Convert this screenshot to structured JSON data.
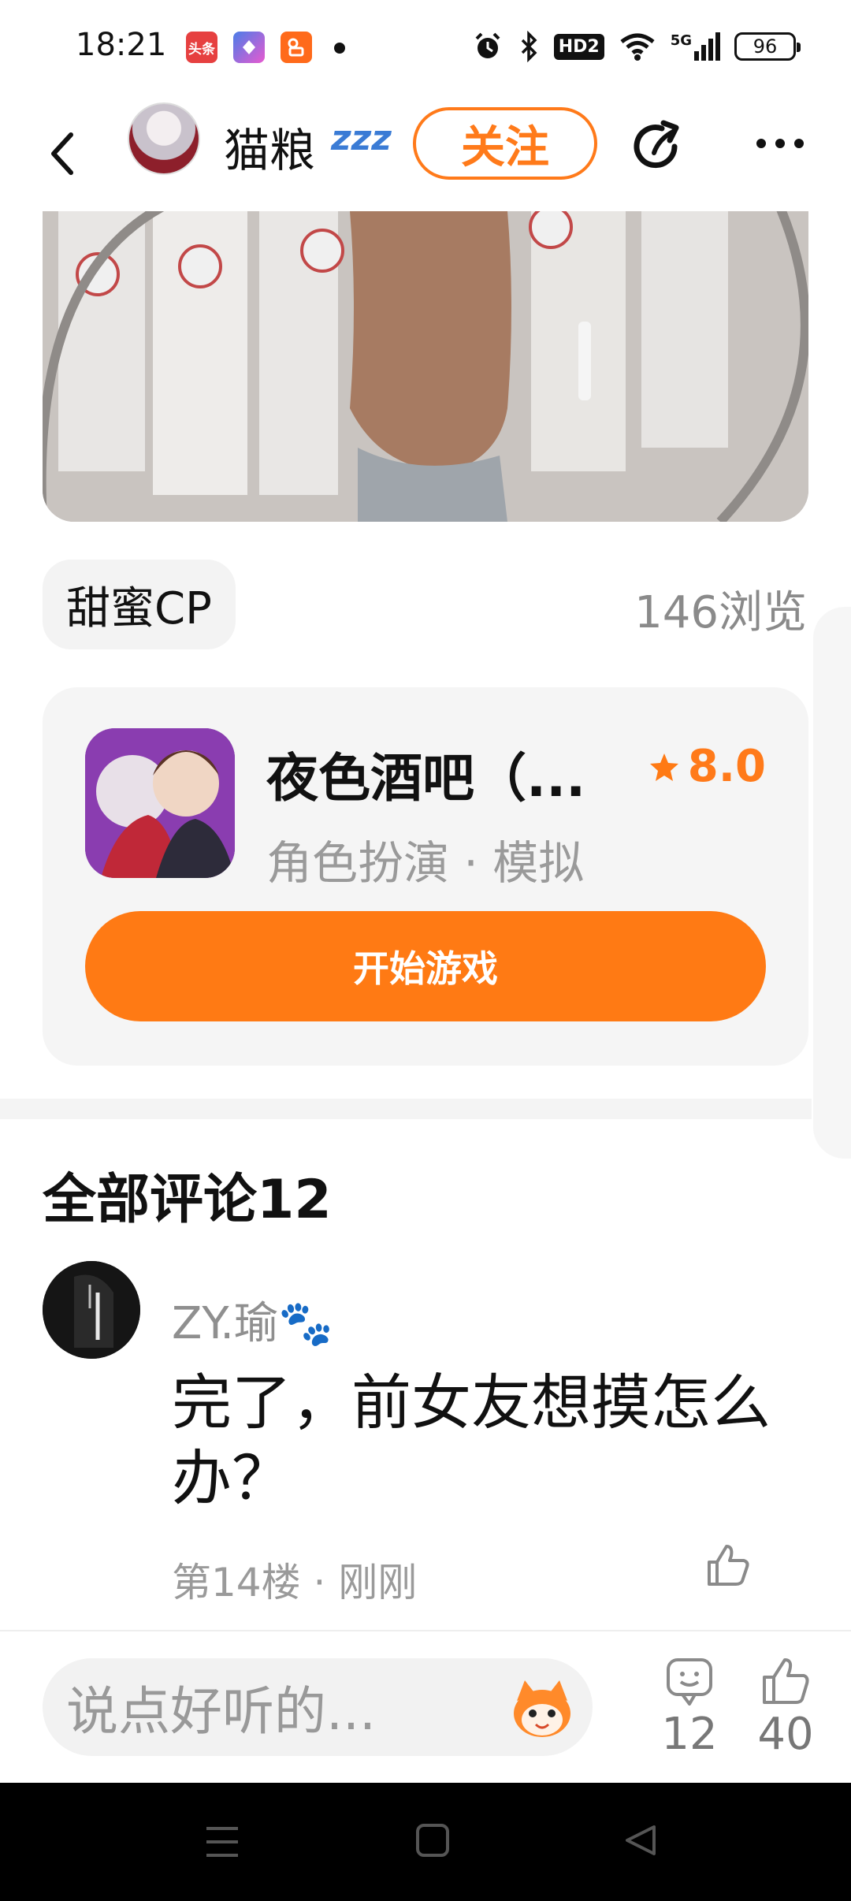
{
  "status_bar": {
    "time": "18:21",
    "apps": [
      {
        "name": "toutiao-app-icon",
        "label": "头条",
        "color": "#e64040"
      },
      {
        "name": "maps-app-icon",
        "label": "",
        "color": "#4a7de8"
      },
      {
        "name": "kuaishou-app-icon",
        "label": "",
        "color": "#ff6a1a"
      }
    ],
    "network_badge": "HD2",
    "signal_label": "5G",
    "battery": "96"
  },
  "header": {
    "user_name": "猫粮",
    "status_emoji": "zzz",
    "follow_label": "关注"
  },
  "post": {
    "tag": "甜蜜CP",
    "views": "146浏览"
  },
  "game_card": {
    "title": "夜色酒吧（...",
    "rating": "8.0",
    "genre": "角色扮演 · 模拟",
    "play_label": "开始游戏"
  },
  "comments": {
    "title": "全部评论12",
    "items": [
      {
        "user": "ZY.瑜🐾",
        "text": "完了，前女友想摸怎么办？",
        "meta": "第14楼 · 刚刚"
      }
    ]
  },
  "bottom_bar": {
    "placeholder": "说点好听的...",
    "comment_count": "12",
    "like_count": "40"
  },
  "colors": {
    "accent": "#ff7a14",
    "muted": "#9a9a9a"
  }
}
